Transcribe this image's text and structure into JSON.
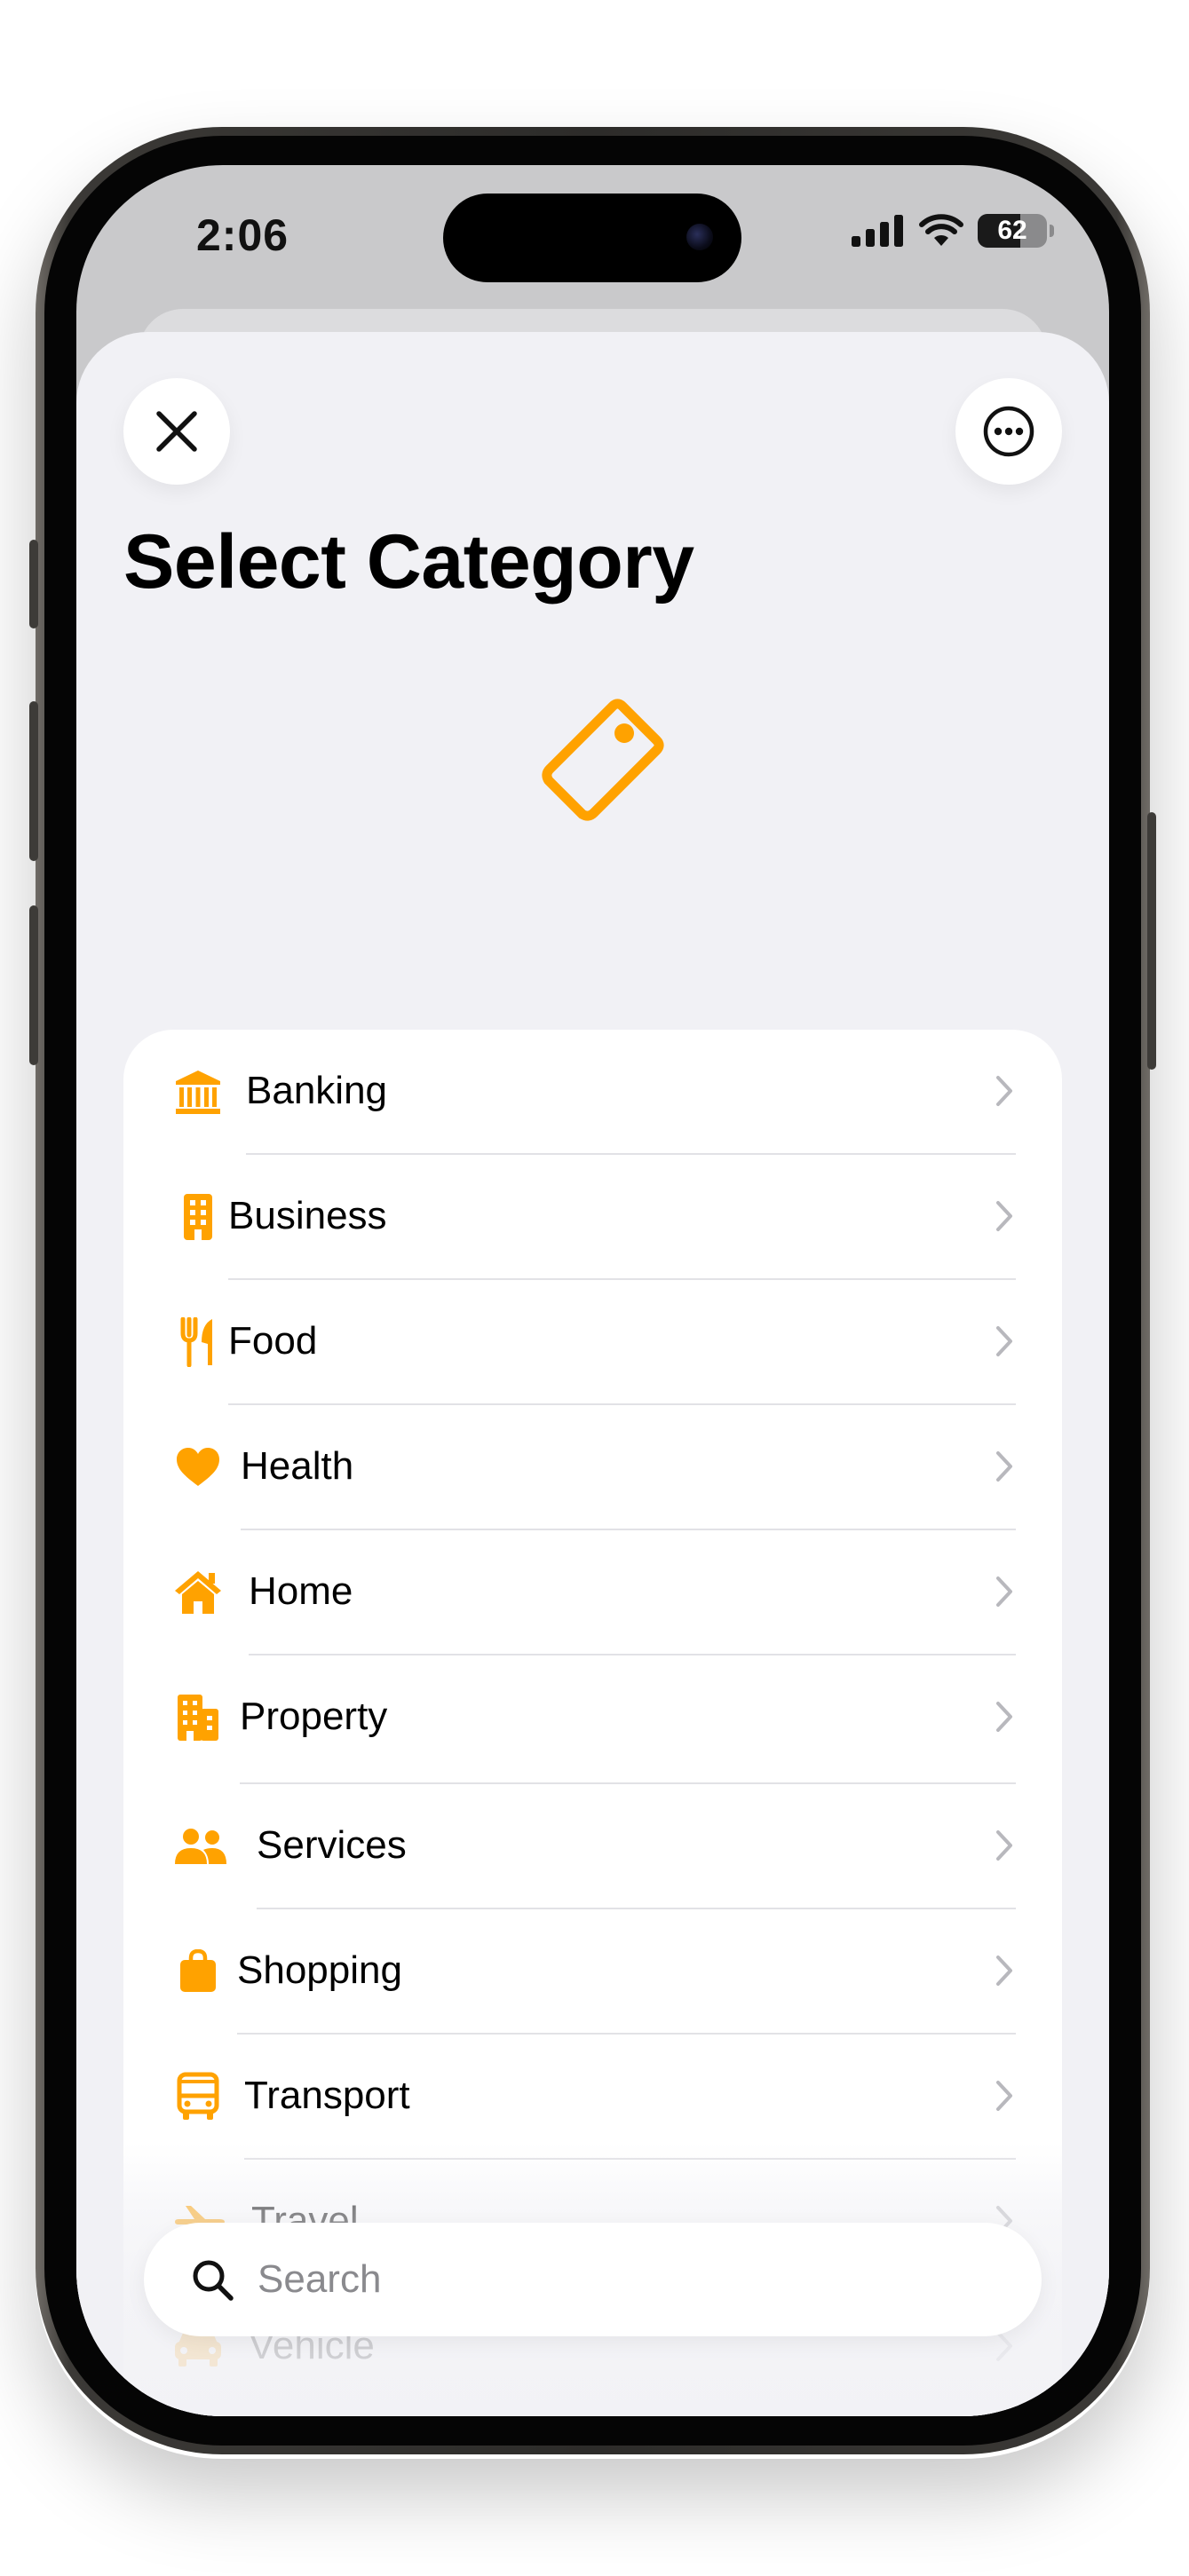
{
  "status_bar": {
    "time": "2:06",
    "battery_level": "62"
  },
  "header": {
    "title": "Select Category",
    "close_icon": "close-icon",
    "more_icon": "ellipsis-circle-icon",
    "hero_icon": "tag-icon"
  },
  "categories": [
    {
      "label": "Banking",
      "icon": "bank-icon"
    },
    {
      "label": "Business",
      "icon": "building-icon"
    },
    {
      "label": "Food",
      "icon": "fork-knife-icon"
    },
    {
      "label": "Health",
      "icon": "heart-icon"
    },
    {
      "label": "Home",
      "icon": "house-icon"
    },
    {
      "label": "Property",
      "icon": "buildings-icon"
    },
    {
      "label": "Services",
      "icon": "people-icon"
    },
    {
      "label": "Shopping",
      "icon": "bag-icon"
    },
    {
      "label": "Transport",
      "icon": "bus-icon"
    },
    {
      "label": "Travel",
      "icon": "airplane-icon"
    },
    {
      "label": "Vehicle",
      "icon": "car-icon"
    }
  ],
  "search": {
    "placeholder": "Search",
    "value": ""
  },
  "colors": {
    "accent": "#FFA200",
    "background": "#F1F1F5",
    "card": "#FFFFFF"
  }
}
